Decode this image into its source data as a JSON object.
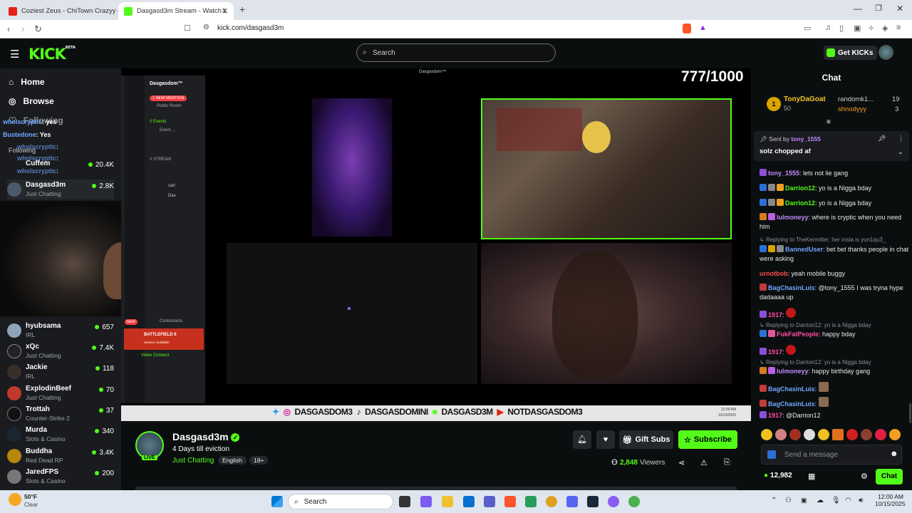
{
  "browser": {
    "tabs": [
      {
        "title": "Coziest Zeus - ChiTown Crazyy (Offici",
        "active": false
      },
      {
        "title": "Dasgasd3m Stream - Watch L",
        "active": true
      }
    ],
    "url": "kick.com/dasgasd3m"
  },
  "header": {
    "logo": "KICK",
    "logo_badge": "BETA",
    "search_placeholder": "Search",
    "get_kicks": "Get KICKs"
  },
  "sidebar": {
    "nav": [
      {
        "label": "Home",
        "icon": "home-icon"
      },
      {
        "label": "Browse",
        "icon": "compass-icon"
      },
      {
        "label": "Following",
        "icon": "heart-icon"
      }
    ],
    "following_label": "Following",
    "channels": [
      {
        "name": "Cuffem",
        "category": "",
        "viewers": "20.4K"
      },
      {
        "name": "Dasgasd3m",
        "category": "Just Chatting",
        "viewers": "2.8K"
      },
      {
        "name": "hyubsama",
        "category": "IRL",
        "viewers": "657"
      },
      {
        "name": "xQc",
        "category": "Just Chatting",
        "viewers": "7.4K"
      },
      {
        "name": "Jackie",
        "category": "IRL",
        "viewers": "118"
      },
      {
        "name": "ExplodinBeef",
        "category": "Just Chatting",
        "viewers": "70"
      },
      {
        "name": "Trottah",
        "category": "Counter-Strike 2",
        "viewers": "37"
      },
      {
        "name": "Murda",
        "category": "Slots & Casino",
        "viewers": "340"
      },
      {
        "name": "Buddha",
        "category": "Red Dead RP",
        "viewers": "3.4K"
      },
      {
        "name": "JaredFPS",
        "category": "Slots & Casino",
        "viewers": "200"
      }
    ],
    "overlay_chat": [
      {
        "user": "wholscryptic",
        "text": ": yes"
      },
      {
        "user": "Bustedone",
        "text": ": Yes"
      },
      {
        "user": "wholscryptic",
        "text": ":"
      },
      {
        "user": "wholscryptic",
        "text": ":"
      },
      {
        "user": "wholscryptic",
        "text": ":"
      },
      {
        "user": "wholscryptic",
        "text": ":"
      }
    ]
  },
  "player": {
    "counter": "777/1000",
    "overlay_title": "Dasgasdom™",
    "discord_server": "Dasgasdom™",
    "discord_mention": "1 NEW MENTION",
    "discord_public_room": "Public Room",
    "discord_events": "// Events",
    "discord_event": "Event ...",
    "discord_stream": "// STREAM",
    "discord_members": [
      "carl",
      "Das"
    ],
    "discord_battlefield": "BATTLEFIELD 6",
    "discord_battlefield_sub": "Season Available!",
    "discord_voice": "Video Connect",
    "discord_contestants": "Contestants",
    "discord_new": "NEW",
    "ticker": [
      "DASGASDOM3",
      "DASGASDOMINI",
      "DASGASD3M",
      "NOTDASGASDOM3"
    ],
    "ticker_time": "12:00 AM",
    "ticker_date": "10/15/2025"
  },
  "stream": {
    "name": "Dasgasd3m",
    "title": "4 Days till eviction",
    "category": "Just Chatting",
    "tags": [
      "English",
      "18+"
    ],
    "live_label": "LIVE",
    "viewers": "2,848",
    "viewers_label": "Viewers",
    "gift_subs": "Gift Subs",
    "subscribe": "Subscribe"
  },
  "chat": {
    "title": "Chat",
    "leaderboard": [
      {
        "rank": "1",
        "name": "TonyDaGoat",
        "score": "50"
      },
      {
        "name": "randomk1...",
        "score": "19"
      },
      {
        "name": "shnodyyy",
        "score": "3"
      }
    ],
    "pinned": {
      "sent_by_label": "Sent by",
      "user": "tony_1555",
      "text": "solz chopped af"
    },
    "messages": [
      {
        "user": "tony_1555",
        "text": ": lets not lie gang",
        "color": "#c38aff"
      },
      {
        "user": "Darrion12",
        "text": ": yo is a Nigga bday",
        "color": "#53fc18"
      },
      {
        "user": "Darrion12",
        "text": ": yo is a Nigga bday",
        "color": "#53fc18"
      },
      {
        "user": "lulmoneyy",
        "text": ": where is cryptic when you need him",
        "color": "#c38aff"
      },
      {
        "reply": "Replying to TheKermitler: her insta is yun1qu3_"
      },
      {
        "user": "BannedUser",
        "text": ": bet bet thanks people in chat were asking",
        "color": "#6fa8ff"
      },
      {
        "user": "urnotbob",
        "text": ": yeah mobile buggy",
        "color": "#ff4d4d"
      },
      {
        "user": "BagChasinLuis",
        "text": ": @tony_1555 I was tryna hype dadaaaa up",
        "color": "#6fa8ff"
      },
      {
        "user": "1917",
        "text": ":",
        "color": "#ff4da6"
      },
      {
        "reply": "Replying to Darrion12: yo is a Nigga bday"
      },
      {
        "user": "FukFatPeople",
        "text": ": happy bday",
        "color": "#ff4da6"
      },
      {
        "user": "1917",
        "text": ":",
        "color": "#ff4da6"
      },
      {
        "reply": "Replying to Darrion12: yo is a Nigga bday"
      },
      {
        "user": "lulmoneyy",
        "text": ": happy birthday gang",
        "color": "#c38aff"
      },
      {
        "user": "BagChasinLuis",
        "text": ":",
        "color": "#6fa8ff"
      },
      {
        "user": "BagChasinLuis",
        "text": ":",
        "color": "#6fa8ff"
      },
      {
        "user": "1917",
        "text": ": @Darrion12",
        "color": "#ff4da6"
      }
    ],
    "placeholder": "Send a message",
    "kicks_balance": "12,982",
    "send_label": "Chat"
  },
  "taskbar": {
    "weather_temp": "50°F",
    "weather_desc": "Clear",
    "search_label": "Search",
    "time": "12:00 AM",
    "date": "10/15/2025"
  }
}
